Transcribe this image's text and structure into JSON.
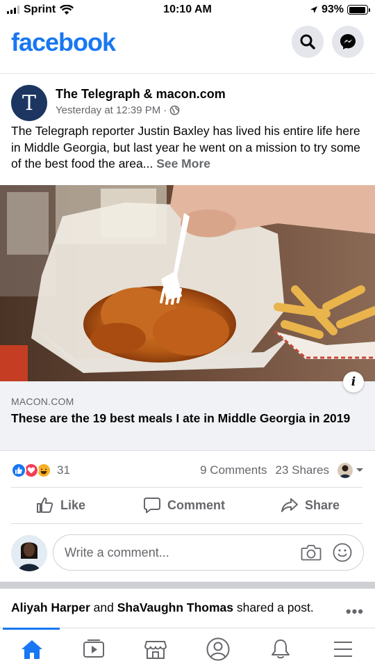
{
  "status_bar": {
    "carrier": "Sprint",
    "time": "10:10 AM",
    "battery": "93%",
    "battery_level": 0.93
  },
  "header": {
    "logo": "facebook",
    "search_icon": "search-icon",
    "messenger_icon": "messenger-icon"
  },
  "post": {
    "page_name": "The Telegraph & macon.com",
    "page_avatar_letter": "T",
    "time": "Yesterday at 12:39 PM",
    "separator": "·",
    "privacy_icon": "globe-icon",
    "text": "The Telegraph reporter Justin Baxley has lived his entire life here in Middle Georgia, but last year he went on a mission to try some of the best food the area...",
    "see_more": "See More",
    "link": {
      "domain": "MACON.COM",
      "title": "These are the 19 best meals I ate in Middle Georgia in 2019",
      "info_label": "i"
    },
    "reactions": {
      "icons": [
        "like-reaction-icon",
        "love-reaction-icon",
        "haha-reaction-icon"
      ],
      "count": "31"
    },
    "comments": "9 Comments",
    "shares": "23 Shares",
    "actions": {
      "like": "Like",
      "comment": "Comment",
      "share": "Share"
    }
  },
  "comment_box": {
    "placeholder": "Write a comment..."
  },
  "next_post": {
    "user1": "Aliyah Harper",
    "connector": " and ",
    "user2": "ShaVaughn Thomas",
    "action": " shared a post."
  },
  "tabbar": {
    "tabs": [
      "home-icon",
      "watch-icon",
      "marketplace-icon",
      "profile-icon",
      "notifications-icon",
      "menu-icon"
    ]
  },
  "colors": {
    "brand": "#1877f2",
    "secondary_text": "#65676b",
    "link_bg": "#f0f2f5"
  }
}
